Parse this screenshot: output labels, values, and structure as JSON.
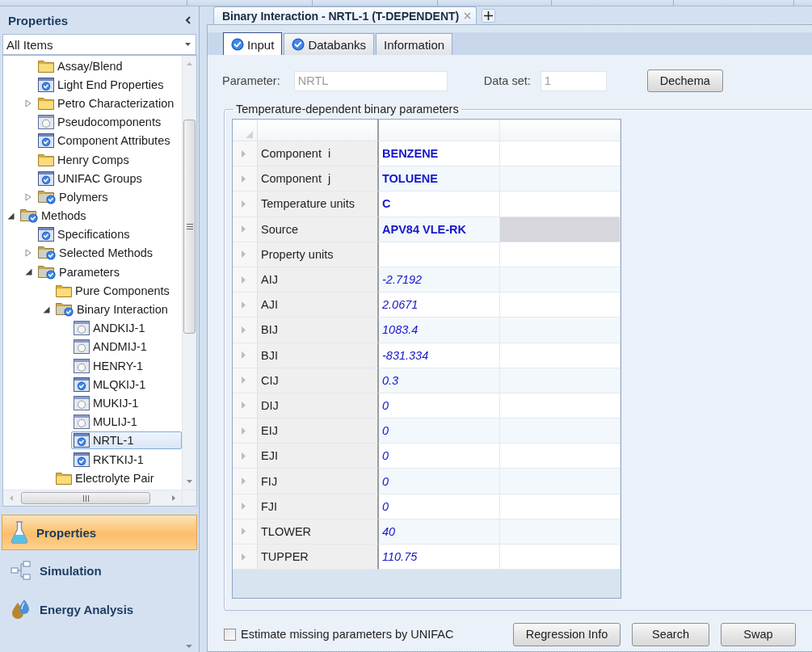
{
  "sidebar": {
    "title": "Properties",
    "filter": {
      "value": "All Items"
    },
    "tree": [
      {
        "children": [
          {
            "label": "Assay/Blend",
            "kind": "folder",
            "selected": false
          },
          {
            "label": "Light End Properties",
            "kind": "form-checked",
            "selected": false
          },
          {
            "label": "Petro Characterization",
            "kind": "folder",
            "expanded": false,
            "selected": false
          },
          {
            "label": "Pseudocomponents",
            "kind": "form-empty",
            "selected": false
          },
          {
            "label": "Component Attributes",
            "kind": "form-checked",
            "selected": false
          },
          {
            "label": "Henry Comps",
            "kind": "folder",
            "selected": false
          },
          {
            "label": "UNIFAC Groups",
            "kind": "form-checked",
            "selected": false
          },
          {
            "label": "Polymers",
            "kind": "folder-checked",
            "expanded": false,
            "selected": false
          }
        ]
      },
      {
        "label": "Methods",
        "kind": "folder-checked",
        "expanded": true,
        "selected": false,
        "children": [
          {
            "label": "Specifications",
            "kind": "form-checked",
            "selected": false
          },
          {
            "label": "Selected Methods",
            "kind": "folder-checked",
            "expanded": false,
            "selected": false
          },
          {
            "label": "Parameters",
            "kind": "folder-checked",
            "expanded": true,
            "selected": false,
            "children": [
              {
                "label": "Pure Components",
                "kind": "folder",
                "selected": false
              },
              {
                "label": "Binary Interaction",
                "kind": "folder-checked",
                "expanded": true,
                "selected": false,
                "children": [
                  {
                    "label": "ANDKIJ-1",
                    "kind": "form-empty",
                    "selected": false
                  },
                  {
                    "label": "ANDMIJ-1",
                    "kind": "form-empty",
                    "selected": false
                  },
                  {
                    "label": "HENRY-1",
                    "kind": "form-empty",
                    "selected": false
                  },
                  {
                    "label": "MLQKIJ-1",
                    "kind": "form-checked",
                    "selected": false
                  },
                  {
                    "label": "MUKIJ-1",
                    "kind": "form-empty",
                    "selected": false
                  },
                  {
                    "label": "MULIJ-1",
                    "kind": "form-empty",
                    "selected": false
                  },
                  {
                    "label": "NRTL-1",
                    "kind": "form-checked",
                    "selected": true
                  },
                  {
                    "label": "RKTKIJ-1",
                    "kind": "form-checked",
                    "selected": false
                  }
                ]
              },
              {
                "label": "Electrolyte Pair",
                "kind": "folder",
                "selected": false
              }
            ]
          }
        ]
      }
    ],
    "nav": [
      {
        "label": "Properties",
        "kind": "flask",
        "selected": true
      },
      {
        "label": "Simulation",
        "kind": "flowsheet",
        "selected": false
      },
      {
        "label": "Energy Analysis",
        "kind": "drops",
        "selected": false
      }
    ]
  },
  "document_tabs": [
    {
      "label": "Binary Interaction - NRTL-1 (T-DEPENDENT)",
      "selected": true
    }
  ],
  "form_tabs": [
    {
      "label": "Input",
      "complete": true,
      "selected": true
    },
    {
      "label": "Databanks",
      "complete": true,
      "selected": false
    },
    {
      "label": "Information",
      "complete": false,
      "selected": false
    }
  ],
  "parameter": {
    "label": "Parameter:",
    "value": "NRTL",
    "disabled": true
  },
  "data_set": {
    "label": "Data set:",
    "value": "1",
    "disabled": true
  },
  "dechema_button": "Dechema",
  "parameters_group": {
    "title": "Temperature-dependent binary parameters",
    "rows": [
      {
        "name": "Component  i",
        "value": "BENZENE",
        "kind": "text",
        "column_3_shaded": false
      },
      {
        "name": "Component  j",
        "value": "TOLUENE",
        "kind": "text",
        "column_3_shaded": false
      },
      {
        "name": "Temperature units",
        "value": "C",
        "kind": "text",
        "column_3_shaded": false
      },
      {
        "name": "Source",
        "value": "APV84 VLE-RK",
        "kind": "text",
        "column_3_shaded": true
      },
      {
        "name": "Property units",
        "kind": "text",
        "column_3_shaded": false
      },
      {
        "name": "AIJ",
        "value": "-2.7192",
        "kind": "number",
        "column_3_shaded": false
      },
      {
        "name": "AJI",
        "value": "2.0671",
        "kind": "number",
        "column_3_shaded": false
      },
      {
        "name": "BIJ",
        "value": "1083.4",
        "kind": "number",
        "column_3_shaded": false
      },
      {
        "name": "BJI",
        "value": "-831.334",
        "kind": "number",
        "column_3_shaded": false
      },
      {
        "name": "CIJ",
        "value": "0.3",
        "kind": "number",
        "column_3_shaded": false
      },
      {
        "name": "DIJ",
        "value": "0",
        "kind": "number",
        "column_3_shaded": false
      },
      {
        "name": "EIJ",
        "value": "0",
        "kind": "number",
        "column_3_shaded": false
      },
      {
        "name": "EJI",
        "value": "0",
        "kind": "number",
        "column_3_shaded": false
      },
      {
        "name": "FIJ",
        "value": "0",
        "kind": "number",
        "column_3_shaded": false
      },
      {
        "name": "FJI",
        "value": "0",
        "kind": "number",
        "column_3_shaded": false
      },
      {
        "name": "TLOWER",
        "value": "40",
        "kind": "number",
        "column_3_shaded": false
      },
      {
        "name": "TUPPER",
        "value": "110.75",
        "kind": "number",
        "column_3_shaded": false
      }
    ]
  },
  "estimate_checkbox": {
    "label": "Estimate missing parameters by UNIFAC",
    "checked": false
  },
  "buttons": [
    "Regression Info",
    "Search",
    "Swap"
  ]
}
